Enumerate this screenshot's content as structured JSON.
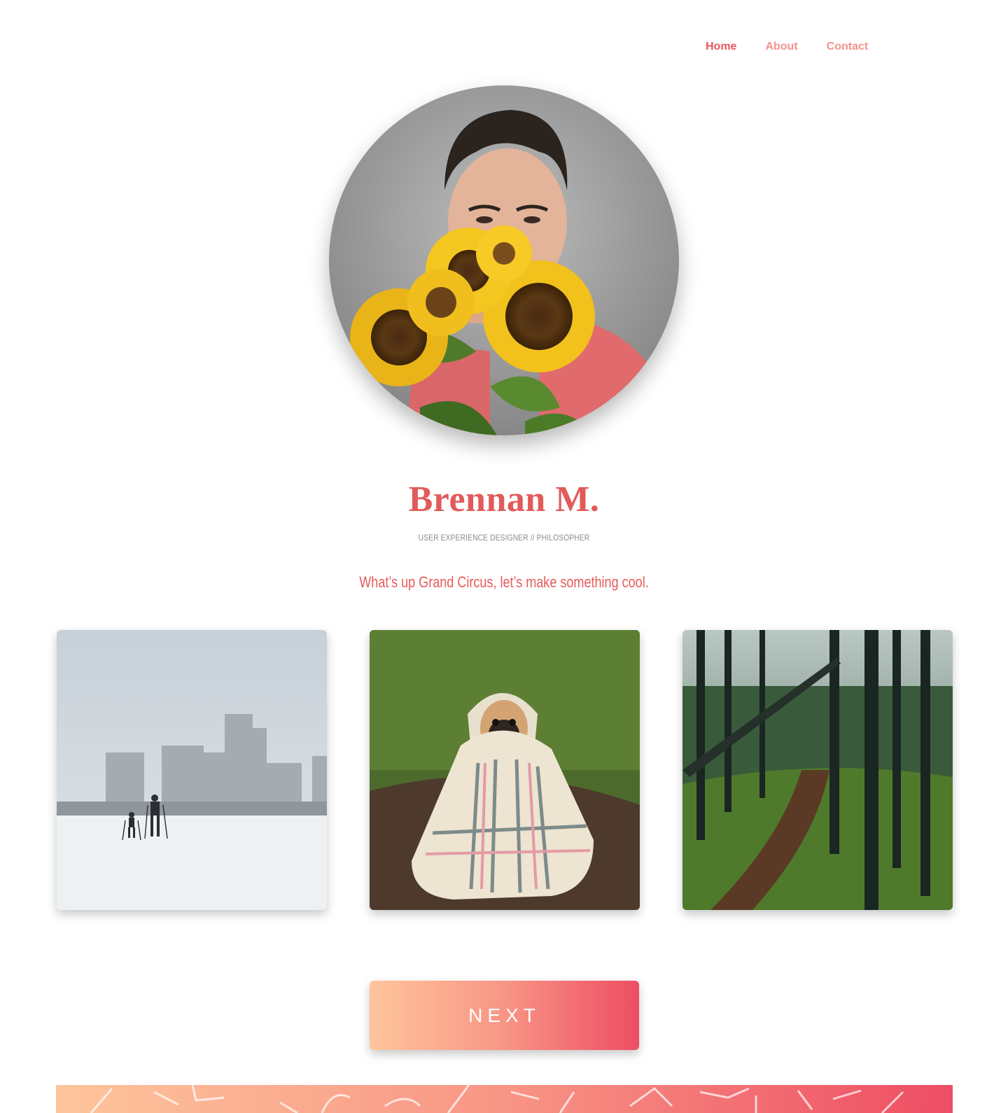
{
  "nav": {
    "items": [
      {
        "label": "Home",
        "active": true
      },
      {
        "label": "About",
        "active": false
      },
      {
        "label": "Contact",
        "active": false
      }
    ]
  },
  "profile": {
    "name": "Brennan M.",
    "role": "USER EXPERIENCE DESIGNER // PHILOSOPHER",
    "tagline": "What’s up Grand Circus, let’s make something cool."
  },
  "gallery": {
    "items": [
      {
        "subject": "skiers-in-snow"
      },
      {
        "subject": "pug-in-blanket"
      },
      {
        "subject": "forest-trail"
      }
    ]
  },
  "next_button": {
    "label": "NEXT"
  },
  "colors": {
    "accent": "#e8575a",
    "nav_link": "#f2928c",
    "gradient_start": "#fec59c",
    "gradient_end": "#ee4d63"
  }
}
